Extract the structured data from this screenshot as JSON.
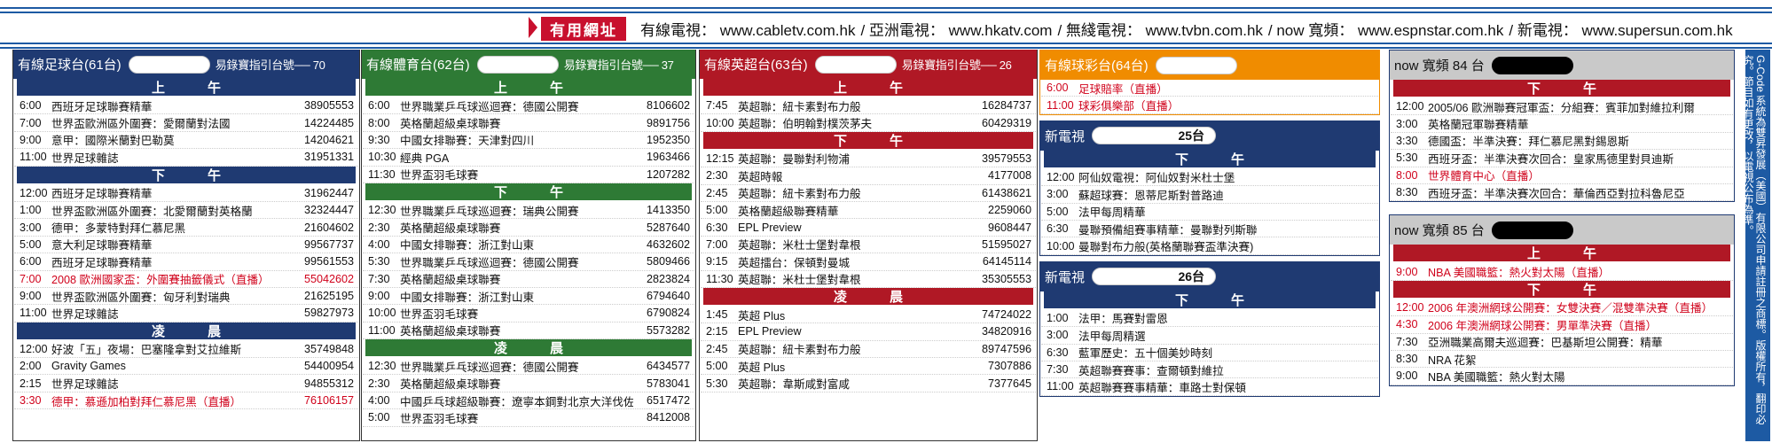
{
  "urls": {
    "tag": "有用網址",
    "items": [
      "有線電視： www.cabletv.com.hk",
      "/ 亞洲電視： www.hkatv.com",
      "/ 無綫電視： www.tvbn.com.hk",
      "/ now 寬頻： www.espnstar.com.hk",
      "/ 新電視： www.supersun.com.hk"
    ]
  },
  "c1": {
    "title": "有線足球台(61台)",
    "guide": "易錄寶指引台號── 70",
    "b1": "上午",
    "b2": "下午",
    "b3": "凌晨",
    "am": [
      {
        "t": "6:00",
        "p": "西班牙足球聯賽精華",
        "n": "38905553"
      },
      {
        "t": "7:00",
        "p": "世界盃歐洲區外圍賽：愛爾蘭對法國",
        "n": "14224485"
      },
      {
        "t": "9:00",
        "p": "意甲：國際米蘭對巴勒莫",
        "n": "14204621"
      },
      {
        "t": "11:00",
        "p": "世界足球雜誌",
        "n": "31951331"
      }
    ],
    "pm": [
      {
        "t": "12:00",
        "p": "西班牙足球聯賽精華",
        "n": "31962447"
      },
      {
        "t": "1:00",
        "p": "世界盃歐洲區外圍賽：北愛爾蘭對英格蘭",
        "n": "32324447"
      },
      {
        "t": "3:00",
        "p": "德甲：多蒙特對拜仁慕尼黑",
        "n": "21604602"
      },
      {
        "t": "5:00",
        "p": "意大利足球聯賽精華",
        "n": "99567737"
      },
      {
        "t": "6:00",
        "p": "西班牙足球聯賽精華",
        "n": "99561553"
      },
      {
        "t": "7:00",
        "p": "2008 歐洲國家盃：外圍賽抽籤儀式（直播）",
        "n": "55042602",
        "red": true
      },
      {
        "t": "9:00",
        "p": "世界盃歐洲區外圍賽：匈牙利對瑞典",
        "n": "21625195"
      },
      {
        "t": "11:00",
        "p": "世界足球雜誌",
        "n": "59827973"
      }
    ],
    "night": [
      {
        "t": "12:00",
        "p": "好波「五」夜場：巴塞隆拿對艾拉維斯",
        "n": "35749848"
      },
      {
        "t": "2:00",
        "p": "Gravity Games",
        "n": "54400954"
      },
      {
        "t": "2:15",
        "p": "世界足球雜誌",
        "n": "94855312"
      },
      {
        "t": "3:30",
        "p": "德甲：慕遜加柏對拜仁慕尼黑（直播）",
        "n": "76106157",
        "red": true
      }
    ]
  },
  "c2": {
    "title": "有線體育台(62台)",
    "guide": "易錄寶指引台號── 37",
    "b1": "上午",
    "b2": "下午",
    "b3": "凌晨",
    "am": [
      {
        "t": "6:00",
        "p": "世界職業乒乓球巡迴賽：德國公開賽",
        "n": "8106602"
      },
      {
        "t": "8:00",
        "p": "英格蘭超級桌球聯賽",
        "n": "9891756"
      },
      {
        "t": "9:30",
        "p": "中國女排聯賽：天津對四川",
        "n": "1952350"
      },
      {
        "t": "10:30",
        "p": "經典 PGA",
        "n": "1963466"
      },
      {
        "t": "11:30",
        "p": "世界盃羽毛球賽",
        "n": "1207282"
      }
    ],
    "pm": [
      {
        "t": "12:30",
        "p": "世界職業乒乓球巡迴賽：瑞典公開賽",
        "n": "1413350"
      },
      {
        "t": "2:30",
        "p": "英格蘭超級桌球聯賽",
        "n": "5287640"
      },
      {
        "t": "4:00",
        "p": "中國女排聯賽：浙江對山東",
        "n": "4632602"
      },
      {
        "t": "5:30",
        "p": "世界職業乒乓球巡迴賽：德國公開賽",
        "n": "5809466"
      },
      {
        "t": "7:30",
        "p": "英格蘭超級桌球聯賽",
        "n": "2823824"
      },
      {
        "t": "9:00",
        "p": "中國女排聯賽：浙江對山東",
        "n": "6794640"
      },
      {
        "t": "10:00",
        "p": "世界盃羽毛球賽",
        "n": "6790824"
      },
      {
        "t": "11:00",
        "p": "英格蘭超級桌球聯賽",
        "n": "5573282"
      }
    ],
    "night": [
      {
        "t": "12:30",
        "p": "世界職業乒乓球巡迴賽：德國公開賽",
        "n": "6434577"
      },
      {
        "t": "2:30",
        "p": "英格蘭超級桌球聯賽",
        "n": "5783041"
      },
      {
        "t": "4:00",
        "p": "中國乒乓球超級聯賽：遼寧本鋼對北京大洋伐佐",
        "n": "6517472"
      },
      {
        "t": "5:00",
        "p": "世界盃羽毛球賽",
        "n": "8412008"
      }
    ]
  },
  "c3": {
    "title": "有線英超台(63台)",
    "guide": "易錄寶指引台號── 26",
    "b1": "上午",
    "b2": "下午",
    "b3": "凌晨",
    "am": [
      {
        "t": "7:45",
        "p": "英超聯：紐卡素對布力般",
        "n": "16284737"
      },
      {
        "t": "10:00",
        "p": "英超聯：伯明翰對樸茨茅夫",
        "n": "60429319"
      }
    ],
    "pm": [
      {
        "t": "12:15",
        "p": "英超聯：曼聯對利物浦",
        "n": "39579553"
      },
      {
        "t": "2:30",
        "p": "英超時報",
        "n": "4177008"
      },
      {
        "t": "2:45",
        "p": "英超聯：紐卡素對布力般",
        "n": "61438621"
      },
      {
        "t": "5:00",
        "p": "英格蘭超級聯賽精華",
        "n": "2259060"
      },
      {
        "t": "6:30",
        "p": "EPL Preview",
        "n": "9608447"
      },
      {
        "t": "7:00",
        "p": "英超聯：米杜士堡對韋根",
        "n": "51595027"
      },
      {
        "t": "9:15",
        "p": "英超擂台：保頓對曼城",
        "n": "64145114"
      },
      {
        "t": "11:30",
        "p": "英超聯：米杜士堡對韋根",
        "n": "35305553"
      }
    ],
    "night": [
      {
        "t": "1:45",
        "p": "英超 Plus",
        "n": "74724022"
      },
      {
        "t": "2:15",
        "p": "EPL Preview",
        "n": "34820916"
      },
      {
        "t": "2:45",
        "p": "英超聯：紐卡素對布力般",
        "n": "89747596"
      },
      {
        "t": "5:00",
        "p": "英超 Plus",
        "n": "7307886"
      },
      {
        "t": "5:30",
        "p": "英超聯：韋斯咸對富咸",
        "n": "7377645"
      }
    ]
  },
  "c4": {
    "s1": {
      "title": "有線球彩台(64台)",
      "rows": [
        {
          "t": "6:00",
          "p": "足球賠率（直播）",
          "red": true
        },
        {
          "t": "11:00",
          "p": "球彩俱樂部（直播）",
          "red": true
        }
      ]
    },
    "s2": {
      "title": "新電視",
      "ch": "25台",
      "band": "下午",
      "rows": [
        {
          "t": "12:00",
          "p": "阿仙奴電視：阿仙奴對米杜士堡"
        },
        {
          "t": "3:00",
          "p": "蘇超球賽：恩蒂尼斯對普路迪"
        },
        {
          "t": "5:00",
          "p": "法甲每周精華"
        },
        {
          "t": "6:30",
          "p": "曼聯預備組賽事精華：曼聯對列斯聯"
        },
        {
          "t": "10:00",
          "p": "曼聯對布力般(英格蘭聯賽盃準決賽)"
        }
      ]
    },
    "s3": {
      "title": "新電視",
      "ch": "26台",
      "band": "下午",
      "rows": [
        {
          "t": "1:00",
          "p": "法甲：馬賽對雷恩"
        },
        {
          "t": "3:00",
          "p": "法甲每周精選"
        },
        {
          "t": "6:30",
          "p": "藍軍歷史：五十個美妙時刻"
        },
        {
          "t": "7:30",
          "p": "英超聯賽賽事：查爾頓對維拉"
        },
        {
          "t": "11:00",
          "p": "英超聯賽賽事精華：車路士對保頓"
        }
      ]
    }
  },
  "c5": {
    "s1": {
      "title": "now 寬頻 84 台",
      "band": "下午",
      "rows": [
        {
          "t": "12:00",
          "p": "2005/06 歐洲聯賽冠軍盃：分組賽：賓菲加對維拉利爾"
        },
        {
          "t": "3:00",
          "p": "英格蘭冠軍聯賽精華"
        },
        {
          "t": "3:30",
          "p": "德國盃：半準決賽：拜仁慕尼黑對錫恩斯"
        },
        {
          "t": "5:30",
          "p": "西班牙盃：半準決賽次回合：皇家馬德里對貝迪斯"
        },
        {
          "t": "8:00",
          "p": "世界體育中心（直播）",
          "red": true
        },
        {
          "t": "8:30",
          "p": "西班牙盃：半準決賽次回合：華倫西亞對拉科魯尼亞"
        }
      ]
    },
    "s2": {
      "title": "now 寬頻 85 台",
      "b1": "上午",
      "b2": "下午",
      "am": [
        {
          "t": "9:00",
          "p": "NBA 美國職籃：熱火對太陽（直播）",
          "red": true
        }
      ],
      "pm": [
        {
          "t": "12:00",
          "p": "2006 年澳洲網球公開賽：女雙決賽／混雙準決賽（直播）",
          "red": true
        },
        {
          "t": "4:30",
          "p": "2006 年澳洲網球公開賽：男單準決賽（直播）",
          "red": true
        },
        {
          "t": "7:30",
          "p": "亞洲職業高爾夫巡迴賽：巴基斯坦公開賽：精華"
        },
        {
          "t": "8:30",
          "p": "NRA 花絮"
        },
        {
          "t": "9:00",
          "p": "NBA 美國職籃：熱火對太陽"
        }
      ]
    }
  },
  "side": {
    "text": "G-Code 系統為雙昇發展（美國）有限公司申請註冊之商標。版權所有，翻印必究。節目如有更改，以電視公布為準。"
  }
}
